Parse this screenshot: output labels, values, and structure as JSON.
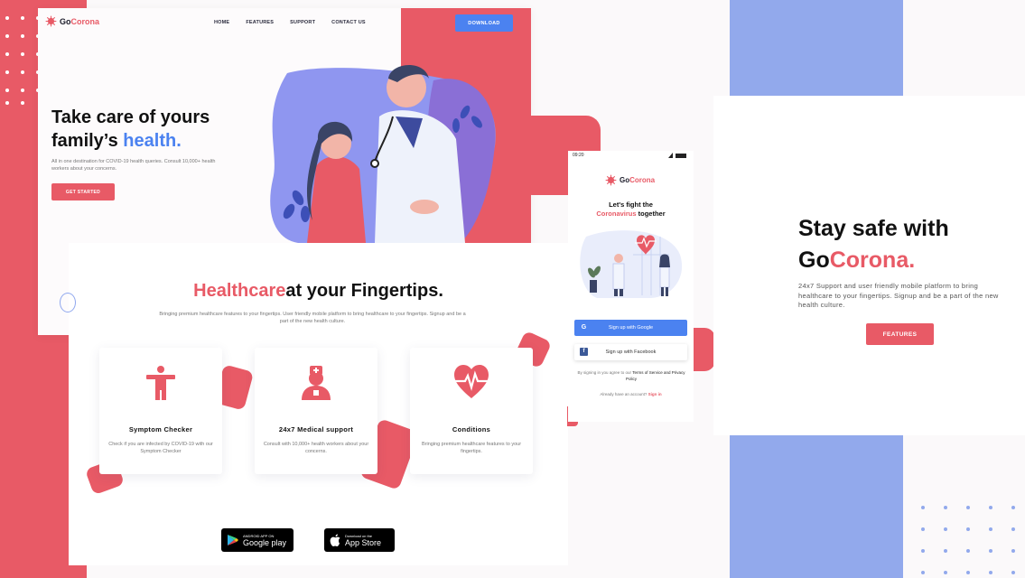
{
  "colors": {
    "accent_red": "#e85a66",
    "accent_blue": "#4b82f0",
    "periwinkle": "#92a9ec"
  },
  "brand": {
    "prefix": "Go",
    "accent": "Corona"
  },
  "nav": [
    {
      "label": "HOME"
    },
    {
      "label": "FEATURES"
    },
    {
      "label": "SUPPORT"
    },
    {
      "label": "CONTACT US"
    }
  ],
  "download_label": "DOWNLOAD",
  "hero": {
    "line1": "Take care of yours",
    "line2_prefix": "family’s ",
    "line2_accent": "health.",
    "subtitle": "All in one destination for COVID-19 health queries. Consult 10,000+ health workers about your concerns.",
    "cta": "GET STARTED"
  },
  "features": {
    "title_accent": "Healthcare",
    "title_rest": "at your Fingertips.",
    "subtitle": "Bringing premium healthcare features to your fingertips. User friendly mobile platform to bring healthcare to your fingertips. Signup and be a part of the new health culture.",
    "cards": [
      {
        "icon": "person-icon",
        "title": "Symptom Checker",
        "desc": "Check if you are infected by COVID-19 with our Symptom Checker"
      },
      {
        "icon": "doctor-icon",
        "title": "24x7 Medical support",
        "desc": "Consult with 10,000+ health workers about your concerns."
      },
      {
        "icon": "heartbeat-icon",
        "title": "Conditions",
        "desc": "Bringing premium healthcare features to your fingertips."
      }
    ],
    "google_play": {
      "small": "ANDROID APP ON",
      "big": "Google play"
    },
    "app_store": {
      "small": "Download on the",
      "big": "App Store"
    }
  },
  "phone": {
    "time": "09:20",
    "title_line1": "Let's fight the",
    "title_accent": "Coronavirus",
    "title_rest": " together",
    "google_btn": "Sign up with Google",
    "facebook_btn": "Sign up with Facebook",
    "terms_prefix": "By signing in you agree to our ",
    "terms_link": "Terms of Service and Privacy Policy",
    "already_prefix": "Already have an account? ",
    "sign_in": "Sign in"
  },
  "promo": {
    "line1": "Stay safe with",
    "line2_prefix": "Go",
    "line2_accent": "Corona.",
    "subtitle": "24x7 Support and user friendly mobile platform to bring healthcare to your fingertips. Signup and be a part of the new health culture.",
    "button": "FEATURES"
  }
}
